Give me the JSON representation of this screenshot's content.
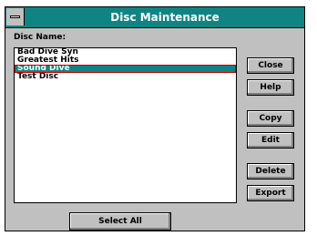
{
  "window": {
    "title": "Disc Maintenance"
  },
  "disc_label": "Disc Name:",
  "disc_list": {
    "items": [
      {
        "label": "Bad Dive Syn"
      },
      {
        "label": "Greatest Hits"
      },
      {
        "label": "Sound Dive",
        "selected": true
      },
      {
        "label": "Test Disc"
      }
    ]
  },
  "buttons": {
    "close": "Close",
    "help": "Help",
    "copy": "Copy",
    "edit": "Edit",
    "delete": "Delete",
    "export": "Export",
    "select_all": "Select All"
  },
  "colors": {
    "titlebar": "#108484",
    "selection": "#108484",
    "selection_outline": "#c00000",
    "face": "#c0c0c0"
  }
}
